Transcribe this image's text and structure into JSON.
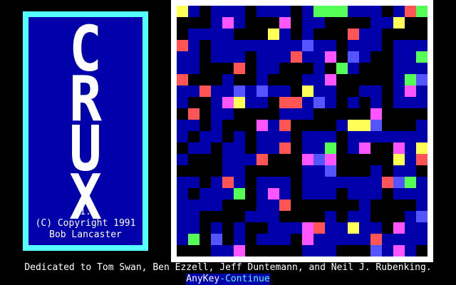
{
  "title": {
    "letters": [
      "C",
      "R",
      "U",
      "X"
    ],
    "version": "v1.1",
    "copyright": "(C) Copyright 1991",
    "author": "Bob Lancaster"
  },
  "footer": {
    "dedication": "Dedicated to Tom Swan, Ben Ezzell, Jeff Duntemann, and Neil J. Rubenking.",
    "key_label": "AnyKey",
    "action_label": "-Continue"
  },
  "board": {
    "grid_size": 22,
    "colors": {
      "background": "#0000AA",
      "empty": "#000000",
      "yellow": "#FFFF55",
      "red": "#FF5555",
      "green": "#55FF55",
      "magenta": "#FF55FF",
      "blue": "#5555FF",
      "frame": "#FFFFFF",
      "title_frame": "#55FFFF"
    }
  }
}
